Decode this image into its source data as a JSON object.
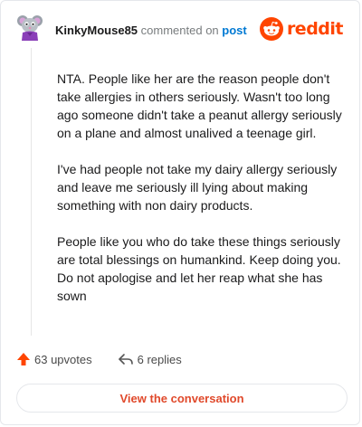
{
  "comment": {
    "username": "KinkyMouse85",
    "verb": "commented on",
    "post_link": "post",
    "paragraphs": [
      "NTA. People like her are the reason people don't take allergies in others seriously. Wasn't too long ago someone didn't take a peanut allergy seriously on a plane and almost unalived a teenage girl.",
      "I've had people not take my dairy allergy seriously and leave me seriously ill lying about making something with non dairy products.",
      "People like you who do take these things seriously are total blessings on humankind. Keep doing you. Do not apologise and let her reap what she has sown"
    ]
  },
  "brand": {
    "name": "reddit",
    "icon": "reddit-snoo-icon",
    "color": "#ff4500"
  },
  "actions": {
    "upvotes_label": "63 upvotes",
    "upvote_icon": "upvote-arrow-icon",
    "replies_label": "6 replies",
    "reply_icon": "reply-icon"
  },
  "footer": {
    "button_label": "View the conversation"
  },
  "colors": {
    "accent": "#ff4500",
    "link": "#0079d3",
    "button_text": "#e0492b"
  }
}
